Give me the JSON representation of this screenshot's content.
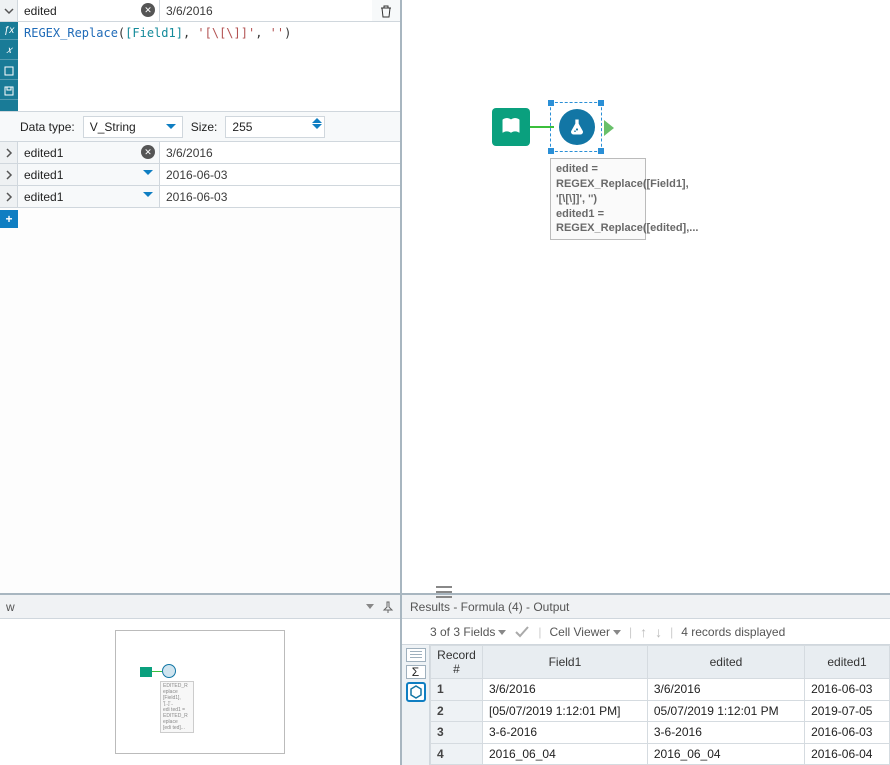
{
  "config": {
    "expanded": {
      "fieldName": "edited",
      "sample": "3/6/2016",
      "expression": {
        "fn": "REGEX_Replace",
        "field": "[Field1]",
        "arg1": "'[\\[\\]]'",
        "arg2": "''"
      },
      "dataTypeLabel": "Data type:",
      "dataType": "V_String",
      "sizeLabel": "Size:",
      "size": "255"
    },
    "rows": [
      {
        "fieldName": "edited1",
        "sample": "3/6/2016",
        "showClear": true
      },
      {
        "fieldName": "edited1",
        "sample": "2016-06-03",
        "showClear": false
      },
      {
        "fieldName": "edited1",
        "sample": "2016-06-03",
        "showClear": false
      }
    ]
  },
  "canvas": {
    "annotation": "edited = REGEX_Replace([Field1], '[\\[\\]]', '')\nedited1 = REGEX_Replace([edited],..."
  },
  "overview": {
    "title": "w",
    "miniAnnotation": "EDITED = REGEX_Replace([Field1], '[..]'..\nedited1 = REGEX_Replace([edi..."
  },
  "results": {
    "title": "Results - Formula (4) - Output",
    "fieldsSummary": "3 of 3 Fields",
    "cellViewer": "Cell Viewer",
    "recordsSummary": "4 records displayed",
    "columns": [
      "Record #",
      "Field1",
      "edited",
      "edited1"
    ],
    "rows": [
      [
        "1",
        "3/6/2016",
        "3/6/2016",
        "2016-06-03"
      ],
      [
        "2",
        "[05/07/2019 1:12:01 PM]",
        "05/07/2019 1:12:01 PM",
        "2019-07-05"
      ],
      [
        "3",
        "3-6-2016",
        "3-6-2016",
        "2016-06-03"
      ],
      [
        "4",
        "2016_06_04",
        "2016_06_04",
        "2016-06-04"
      ]
    ]
  }
}
